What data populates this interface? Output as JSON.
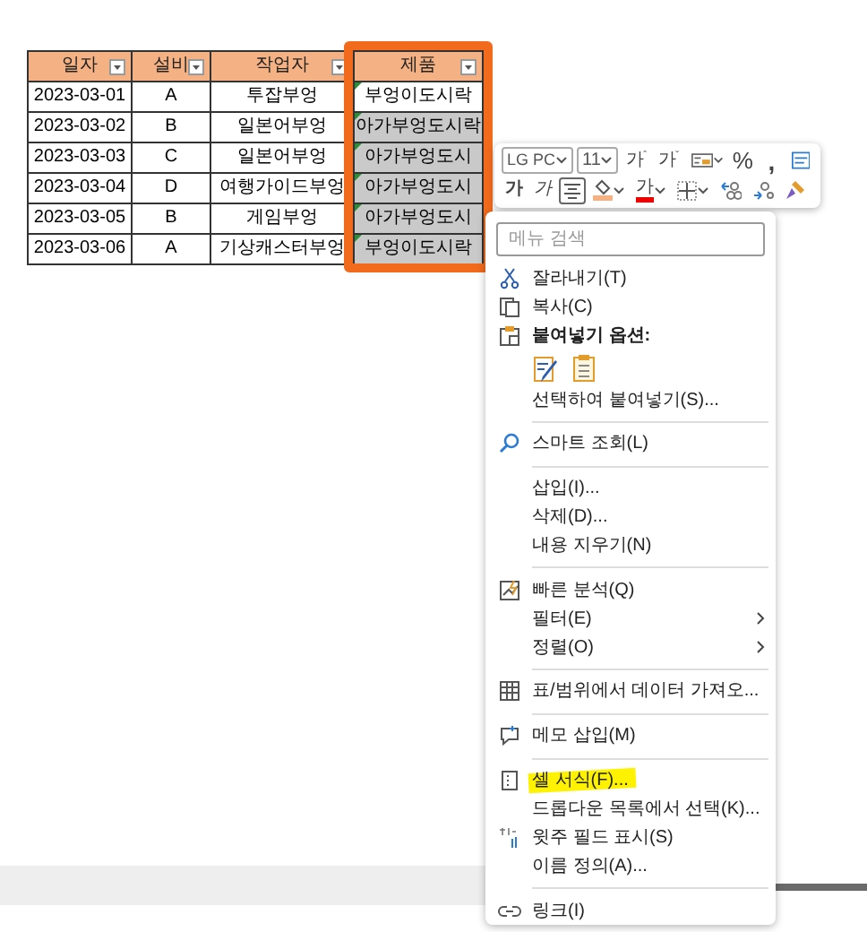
{
  "table": {
    "columns": [
      {
        "label": "일자"
      },
      {
        "label": "설비"
      },
      {
        "label": "작업자"
      },
      {
        "label": "제품"
      }
    ],
    "rows": [
      {
        "cells": [
          "2023-03-01",
          "A",
          "투잡부엉",
          "부엉이도시락"
        ],
        "selected": false
      },
      {
        "cells": [
          "2023-03-02",
          "B",
          "일본어부엉",
          "아가부엉도시락"
        ],
        "selected": true
      },
      {
        "cells": [
          "2023-03-03",
          "C",
          "일본어부엉",
          "아가부엉도시"
        ],
        "selected": true
      },
      {
        "cells": [
          "2023-03-04",
          "D",
          "여행가이드부엉",
          "아가부엉도시"
        ],
        "selected": true
      },
      {
        "cells": [
          "2023-03-05",
          "B",
          "게임부엉",
          "아가부엉도시"
        ],
        "selected": true
      },
      {
        "cells": [
          "2023-03-06",
          "A",
          "기상캐스터부엉",
          "부엉이도시락"
        ],
        "selected": true
      }
    ]
  },
  "toolbar": {
    "font": "LG PC",
    "size": "11",
    "row_1": [
      {
        "kind": "grow",
        "label": "가"
      },
      {
        "kind": "shrink",
        "label": "가"
      },
      {
        "kind": "number-format"
      },
      {
        "kind": "percent",
        "label": "%"
      },
      {
        "kind": "comma",
        "label": ","
      },
      {
        "kind": "wrap"
      }
    ],
    "row_2": [
      {
        "kind": "bold",
        "label": "가",
        "on": false
      },
      {
        "kind": "italic",
        "label": "가",
        "on": false
      },
      {
        "kind": "center",
        "on": true
      },
      {
        "kind": "fill-color",
        "on": false
      },
      {
        "kind": "font-color",
        "label": "가",
        "on": false
      },
      {
        "kind": "borders",
        "on": false
      },
      {
        "kind": "inc-decimal",
        "on": false
      },
      {
        "kind": "dec-decimal",
        "on": false
      },
      {
        "kind": "format-painter",
        "on": false
      }
    ]
  },
  "menu": {
    "search": {
      "placeholder": "메뉴 검색"
    },
    "items": [
      {
        "kind": "item",
        "label": "잘라내기(T)"
      },
      {
        "kind": "item",
        "label": "복사(C)"
      },
      {
        "kind": "header",
        "label": "붙여넣기 옵션:"
      },
      {
        "kind": "paste-options"
      },
      {
        "kind": "item",
        "label": "선택하여 붙여넣기(S)..."
      },
      {
        "kind": "separator"
      },
      {
        "kind": "item",
        "label": "스마트 조회(L)"
      },
      {
        "kind": "separator"
      },
      {
        "kind": "item",
        "label": "삽입(I)..."
      },
      {
        "kind": "item",
        "label": "삭제(D)..."
      },
      {
        "kind": "item",
        "label": "내용 지우기(N)"
      },
      {
        "kind": "separator"
      },
      {
        "kind": "item",
        "label": "빠른 분석(Q)"
      },
      {
        "kind": "submenu",
        "label": "필터(E)"
      },
      {
        "kind": "submenu",
        "label": "정렬(O)"
      },
      {
        "kind": "separator"
      },
      {
        "kind": "item",
        "label": "표/범위에서 데이터 가져오..."
      },
      {
        "kind": "separator"
      },
      {
        "kind": "item",
        "label": "메모 삽입(M)"
      },
      {
        "kind": "separator"
      },
      {
        "kind": "item",
        "label": "셀 서식(F)...",
        "highlighted": true
      },
      {
        "kind": "item",
        "label": "드롭다운 목록에서 선택(K)..."
      },
      {
        "kind": "item",
        "label": "윗주 필드 표시(S)"
      },
      {
        "kind": "item",
        "label": "이름 정의(A)..."
      },
      {
        "kind": "separator"
      },
      {
        "kind": "item",
        "label": "링크(I)"
      }
    ]
  }
}
